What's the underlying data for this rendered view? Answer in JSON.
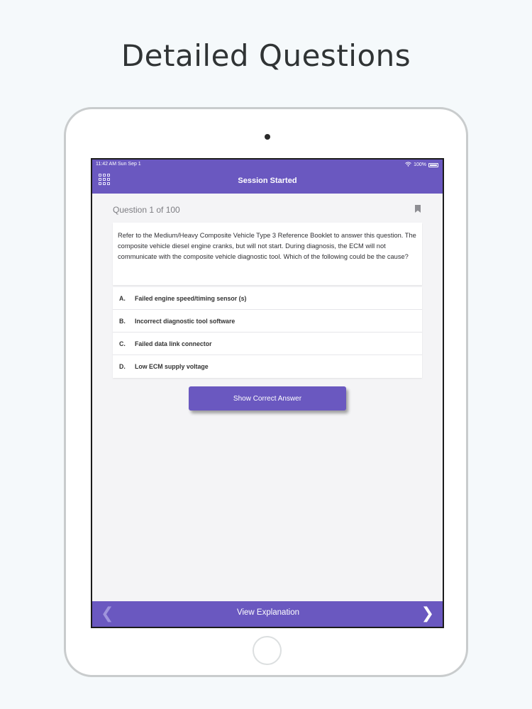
{
  "headline": "Detailed Questions",
  "colors": {
    "accent": "#6a58c0",
    "background": "#f5f9fb",
    "screen_bg": "#f4f4f6"
  },
  "status_bar": {
    "time": "11:42 AM   Sun Sep 1",
    "battery": "100%",
    "icons": [
      "wifi-icon",
      "battery-icon"
    ]
  },
  "nav": {
    "title": "Session Started",
    "menu_icon": "grid-icon"
  },
  "question": {
    "counter": "Question 1 of 100",
    "bookmark_icon": "bookmark-icon",
    "text": "Refer to the Medium/Heavy Composite Vehicle Type 3 Reference Booklet to answer this question. The composite vehicle diesel engine cranks, but will not start. During diagnosis, the ECM will not communicate with the composite vehicle diagnostic tool. Which of the following could be the cause?",
    "options": [
      {
        "letter": "A.",
        "text": "Failed engine speed/timing sensor (s)"
      },
      {
        "letter": "B.",
        "text": "Incorrect diagnostic tool software"
      },
      {
        "letter": "C.",
        "text": "Failed data link connector"
      },
      {
        "letter": "D.",
        "text": "Low ECM supply voltage"
      }
    ]
  },
  "show_answer_label": "Show Correct Answer",
  "bottom_bar": {
    "explanation_label": "View Explanation",
    "prev_icon": "chevron-left-icon",
    "next_icon": "chevron-right-icon"
  }
}
